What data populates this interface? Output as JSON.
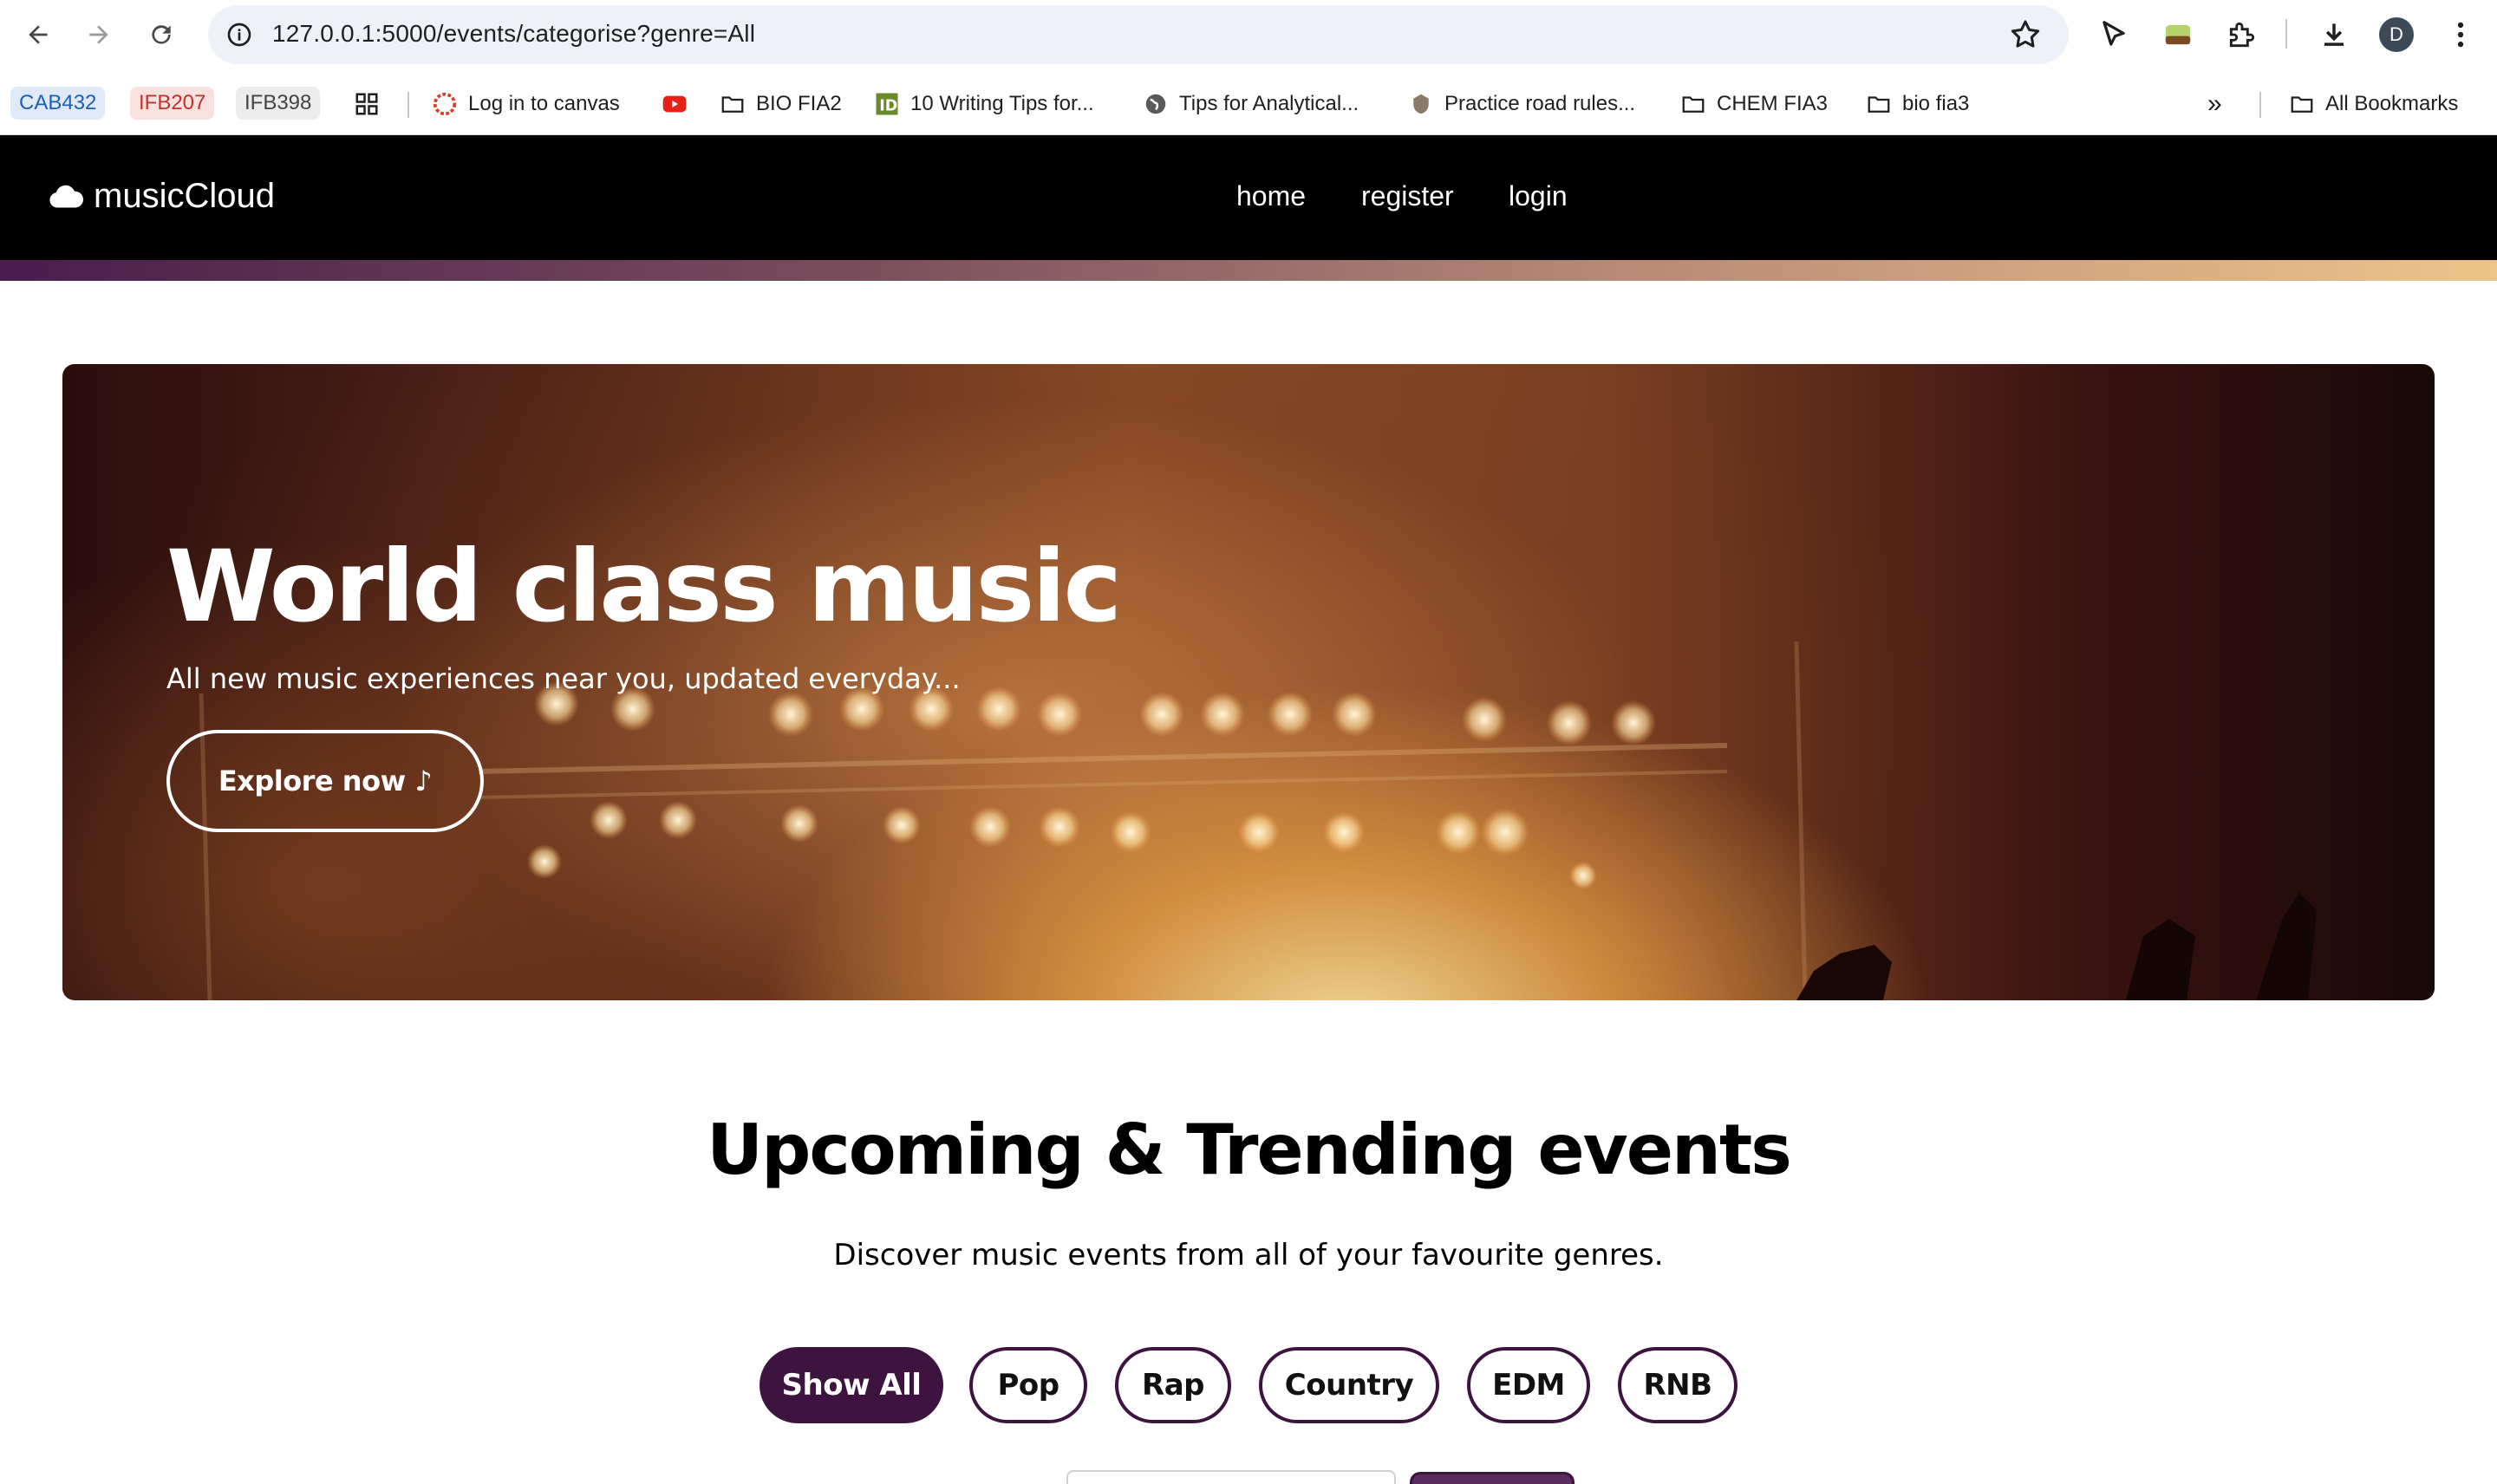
{
  "browser": {
    "url": "127.0.0.1:5000/events/categorise?genre=All",
    "profile_initial": "D",
    "bookmarks": {
      "chips": [
        "CAB432",
        "IFB207",
        "IFB398"
      ],
      "items": [
        "Log in to canvas",
        "BIO FIA2",
        "10 Writing Tips for...",
        "Tips for Analytical...",
        "Practice road rules...",
        "CHEM FIA3",
        "bio fia3"
      ],
      "overflow": "»",
      "all_bookmarks": "All Bookmarks"
    }
  },
  "site": {
    "brand": "musicCloud",
    "nav": [
      "home",
      "register",
      "login"
    ]
  },
  "hero": {
    "title": "World class music",
    "subtitle": "All new music experiences near you, updated everyday...",
    "cta": "Explore now ♪"
  },
  "events": {
    "title": "Upcoming & Trending events",
    "subtitle": "Discover music events from all of your favourite genres.",
    "filters": [
      "Show All",
      "Pop",
      "Rap",
      "Country",
      "EDM",
      "RNB"
    ],
    "active_filter": "Show All"
  },
  "colors": {
    "accent": "#3d1340",
    "nav_bg": "#000000"
  }
}
